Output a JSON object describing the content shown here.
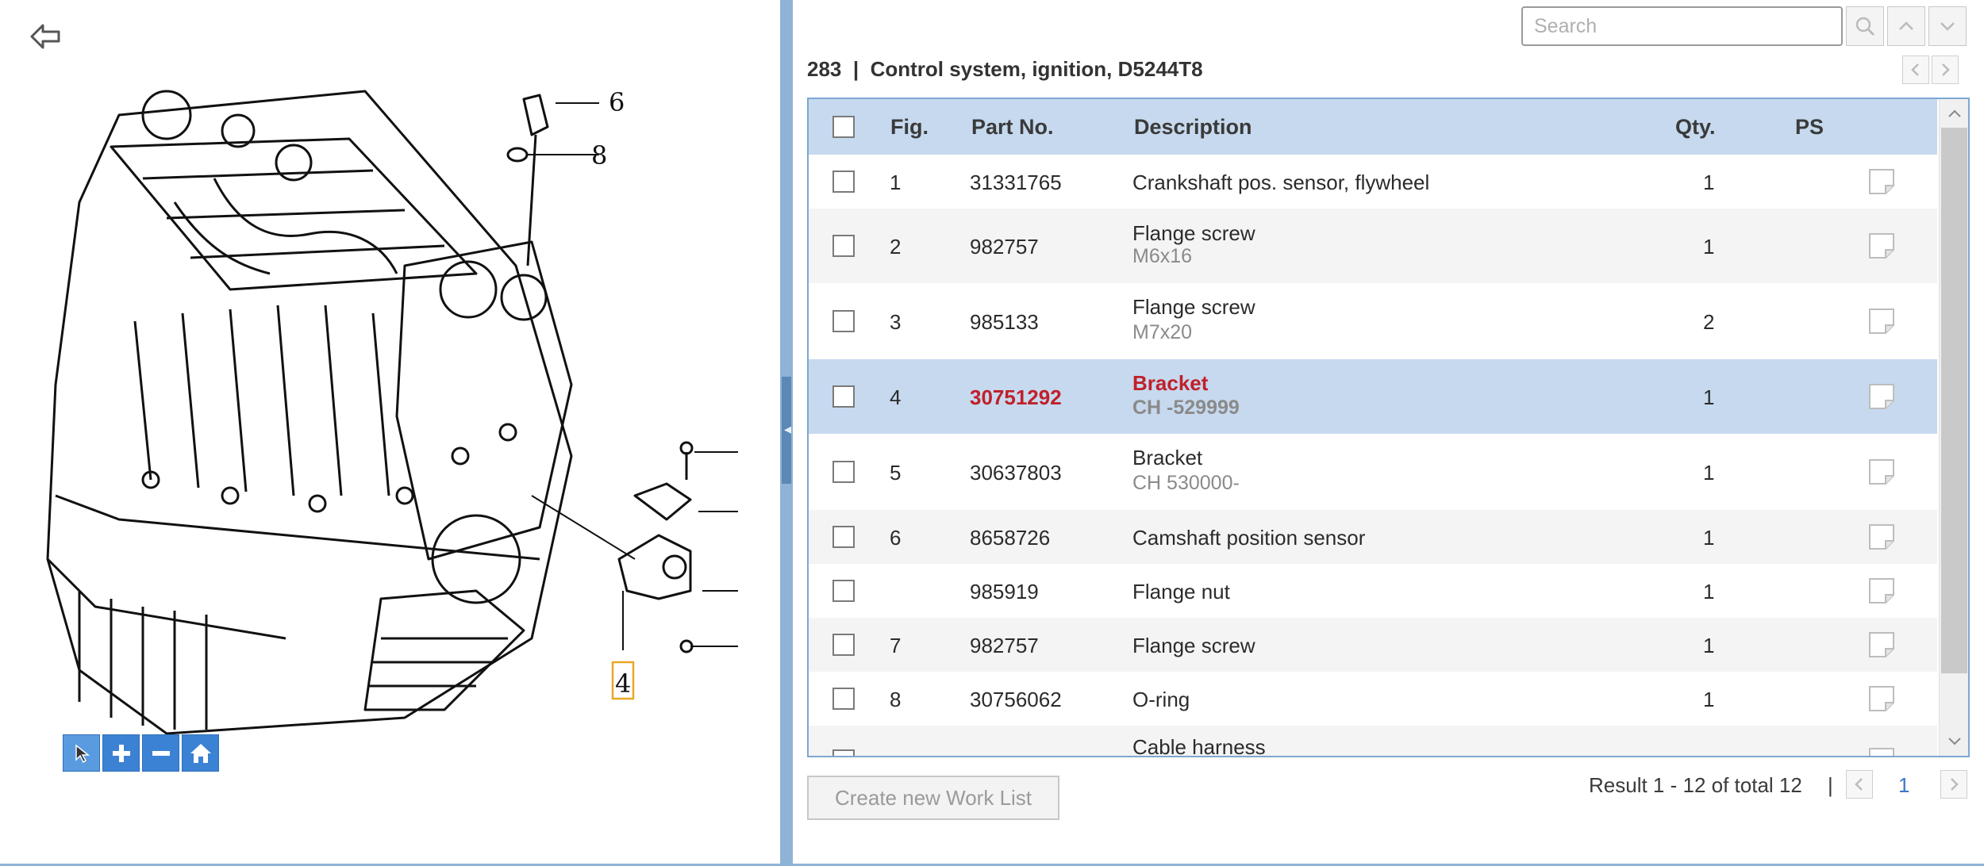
{
  "diagram": {
    "callouts": [
      "6",
      "8",
      "4"
    ],
    "tools": [
      "select-tool",
      "zoom-in-tool",
      "zoom-out-tool",
      "home-tool"
    ]
  },
  "search": {
    "placeholder": "Search",
    "value": ""
  },
  "group": {
    "number": "283",
    "separator": "|",
    "title": "Control system, ignition, D5244T8"
  },
  "table": {
    "headers": {
      "fig": "Fig.",
      "part_no": "Part No.",
      "description": "Description",
      "qty": "Qty.",
      "ps": "PS"
    },
    "rows": [
      {
        "fig": "1",
        "part_no": "31331765",
        "description": "Crankshaft pos. sensor, flywheel",
        "sub": "",
        "qty": "1"
      },
      {
        "fig": "2",
        "part_no": "982757",
        "description": "Flange screw",
        "sub": "M6x16",
        "qty": "1"
      },
      {
        "fig": "3",
        "part_no": "985133",
        "description": "Flange screw",
        "sub": "M7x20",
        "qty": "2"
      },
      {
        "fig": "4",
        "part_no": "30751292",
        "description": "Bracket",
        "sub": "CH -529999",
        "qty": "1",
        "selected": true
      },
      {
        "fig": "5",
        "part_no": "30637803",
        "description": "Bracket",
        "sub": "CH 530000-",
        "qty": "1"
      },
      {
        "fig": "6",
        "part_no": "8658726",
        "description": "Camshaft position sensor",
        "sub": "",
        "qty": "1"
      },
      {
        "fig": "",
        "part_no": "985919",
        "description": "Flange nut",
        "sub": "",
        "qty": "1"
      },
      {
        "fig": "7",
        "part_no": "982757",
        "description": "Flange screw",
        "sub": "",
        "qty": "1"
      },
      {
        "fig": "8",
        "part_no": "30756062",
        "description": "O-ring",
        "sub": "",
        "qty": "1"
      },
      {
        "fig": "",
        "part_no": "",
        "description": "Cable harness",
        "sub": "",
        "qty": ""
      }
    ]
  },
  "footer": {
    "create_worklist_label": "Create new Work List",
    "result_text": "Result 1 - 12 of total 12",
    "pager_separator": "|",
    "current_page": "1"
  },
  "colors": {
    "accent": "#3b82d4",
    "header_bg": "#c6d9ee",
    "selected_text": "#c0202a",
    "splitter": "#8fb3d6"
  }
}
